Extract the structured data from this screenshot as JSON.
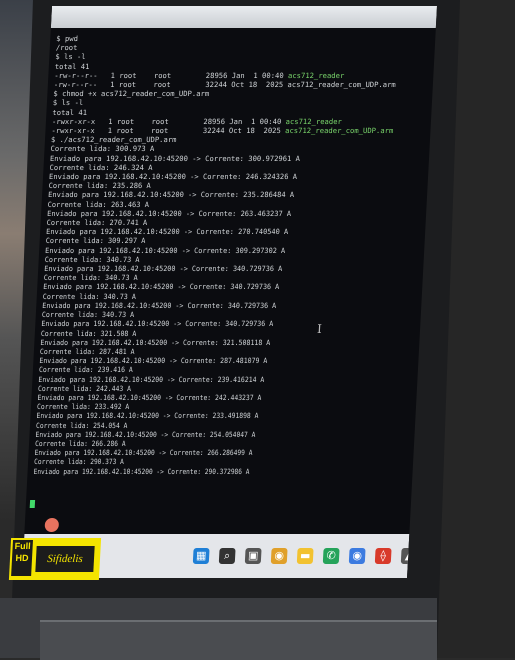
{
  "terminal": {
    "lines": [
      {
        "text": "$ pwd",
        "exec": false
      },
      {
        "text": "/root",
        "exec": false
      },
      {
        "text": "$ ls -l",
        "exec": false
      },
      {
        "text": "total 41",
        "exec": false
      },
      {
        "text": "-rw-r--r--   1 root    root        28956 Jan  1 00:40 ",
        "exec": false,
        "tail": "acs712_reader"
      },
      {
        "text": "-rw-r--r--   1 root    root        32244 Oct 18  2025 acs712_reader_com_UDP.arm",
        "exec": false
      },
      {
        "text": "$ chmod +x acs712_reader_com_UDP.arm",
        "exec": false
      },
      {
        "text": "$ ls -l",
        "exec": false
      },
      {
        "text": "total 41",
        "exec": false
      },
      {
        "text": "-rwxr-xr-x   1 root    root        28956 Jan  1 00:40 ",
        "exec": false,
        "tail": "acs712_reader"
      },
      {
        "text": "-rwxr-xr-x   1 root    root        32244 Oct 18  2025 ",
        "exec": false,
        "tail": "acs712_reader_com_UDP.arm"
      },
      {
        "text": "$ ./acs712_reader_com_UDP.arm",
        "exec": false
      },
      {
        "text": "Corrente lida: 300.973 A",
        "exec": false
      },
      {
        "text": "Enviado para 192.168.42.10:45200 -> Corrente: 300.972961 A",
        "exec": false
      },
      {
        "text": "Corrente lida: 246.324 A",
        "exec": false
      },
      {
        "text": "Enviado para 192.168.42.10:45200 -> Corrente: 246.324326 A",
        "exec": false
      },
      {
        "text": "Corrente lida: 235.286 A",
        "exec": false
      },
      {
        "text": "Enviado para 192.168.42.10:45200 -> Corrente: 235.286484 A",
        "exec": false
      },
      {
        "text": "Corrente lida: 263.463 A",
        "exec": false
      },
      {
        "text": "Enviado para 192.168.42.10:45200 -> Corrente: 263.463237 A",
        "exec": false
      },
      {
        "text": "Corrente lida: 270.741 A",
        "exec": false
      },
      {
        "text": "Enviado para 192.168.42.10:45200 -> Corrente: 270.740540 A",
        "exec": false
      },
      {
        "text": "Corrente lida: 309.297 A",
        "exec": false
      },
      {
        "text": "Enviado para 192.168.42.10:45200 -> Corrente: 309.297302 A",
        "exec": false
      },
      {
        "text": "Corrente lida: 340.73 A",
        "exec": false
      },
      {
        "text": "Enviado para 192.168.42.10:45200 -> Corrente: 340.729736 A",
        "exec": false
      },
      {
        "text": "Corrente lida: 340.73 A",
        "exec": false
      },
      {
        "text": "Enviado para 192.168.42.10:45200 -> Corrente: 340.729736 A",
        "exec": false
      },
      {
        "text": "Corrente lida: 340.73 A",
        "exec": false
      },
      {
        "text": "Enviado para 192.168.42.10:45200 -> Corrente: 340.729736 A",
        "exec": false
      },
      {
        "text": "Corrente lida: 340.73 A",
        "exec": false
      },
      {
        "text": "Enviado para 192.168.42.10:45200 -> Corrente: 340.729736 A",
        "exec": false
      },
      {
        "text": "Corrente lida: 321.508 A",
        "exec": false
      },
      {
        "text": "Enviado para 192.168.42.10:45200 -> Corrente: 321.508118 A",
        "exec": false
      },
      {
        "text": "Corrente lida: 287.481 A",
        "exec": false
      },
      {
        "text": "Enviado para 192.168.42.10:45200 -> Corrente: 287.481079 A",
        "exec": false
      },
      {
        "text": "Corrente lida: 239.416 A",
        "exec": false
      },
      {
        "text": "Enviado para 192.168.42.10:45200 -> Corrente: 239.416214 A",
        "exec": false
      },
      {
        "text": "Corrente lida: 242.443 A",
        "exec": false
      },
      {
        "text": "Enviado para 192.168.42.10:45200 -> Corrente: 242.443237 A",
        "exec": false
      },
      {
        "text": "Corrente lida: 233.492 A",
        "exec": false
      },
      {
        "text": "Enviado para 192.168.42.10:45200 -> Corrente: 233.491898 A",
        "exec": false
      },
      {
        "text": "Corrente lida: 254.054 A",
        "exec": false
      },
      {
        "text": "Enviado para 192.168.42.10:45200 -> Corrente: 254.054047 A",
        "exec": false
      },
      {
        "text": "Corrente lida: 266.286 A",
        "exec": false
      },
      {
        "text": "Enviado para 192.168.42.10:45200 -> Corrente: 266.286499 A",
        "exec": false
      },
      {
        "text": "Corrente lida: 290.373 A",
        "exec": false
      },
      {
        "text": "Enviado para 192.168.42.10:45200 -> Corrente: 290.372986 A",
        "exec": false
      }
    ],
    "exec_color": "#79d46b",
    "cursor_color": "#42d96a"
  },
  "taskbar": {
    "icons": [
      {
        "name": "windows-start-icon",
        "glyph": "▦",
        "color": "#1f7fd6"
      },
      {
        "name": "search-icon",
        "glyph": "⌕",
        "color": "#333333"
      },
      {
        "name": "task-view-icon",
        "glyph": "▣",
        "color": "#555555"
      },
      {
        "name": "chrome-icon",
        "glyph": "◉",
        "color": "#e0a02a"
      },
      {
        "name": "file-explorer-icon",
        "glyph": "▬",
        "color": "#f2c230"
      },
      {
        "name": "whatsapp-icon",
        "glyph": "✆",
        "color": "#25a35a"
      },
      {
        "name": "chrome-alt-icon",
        "glyph": "◉",
        "color": "#3c7be0"
      },
      {
        "name": "pdf-reader-icon",
        "glyph": "⟠",
        "color": "#d83a2a"
      },
      {
        "name": "app-icon",
        "glyph": "▲",
        "color": "#555555"
      }
    ]
  },
  "stickers": {
    "hd_label": "Full\nHD",
    "logo_text": "Sifidelis"
  }
}
